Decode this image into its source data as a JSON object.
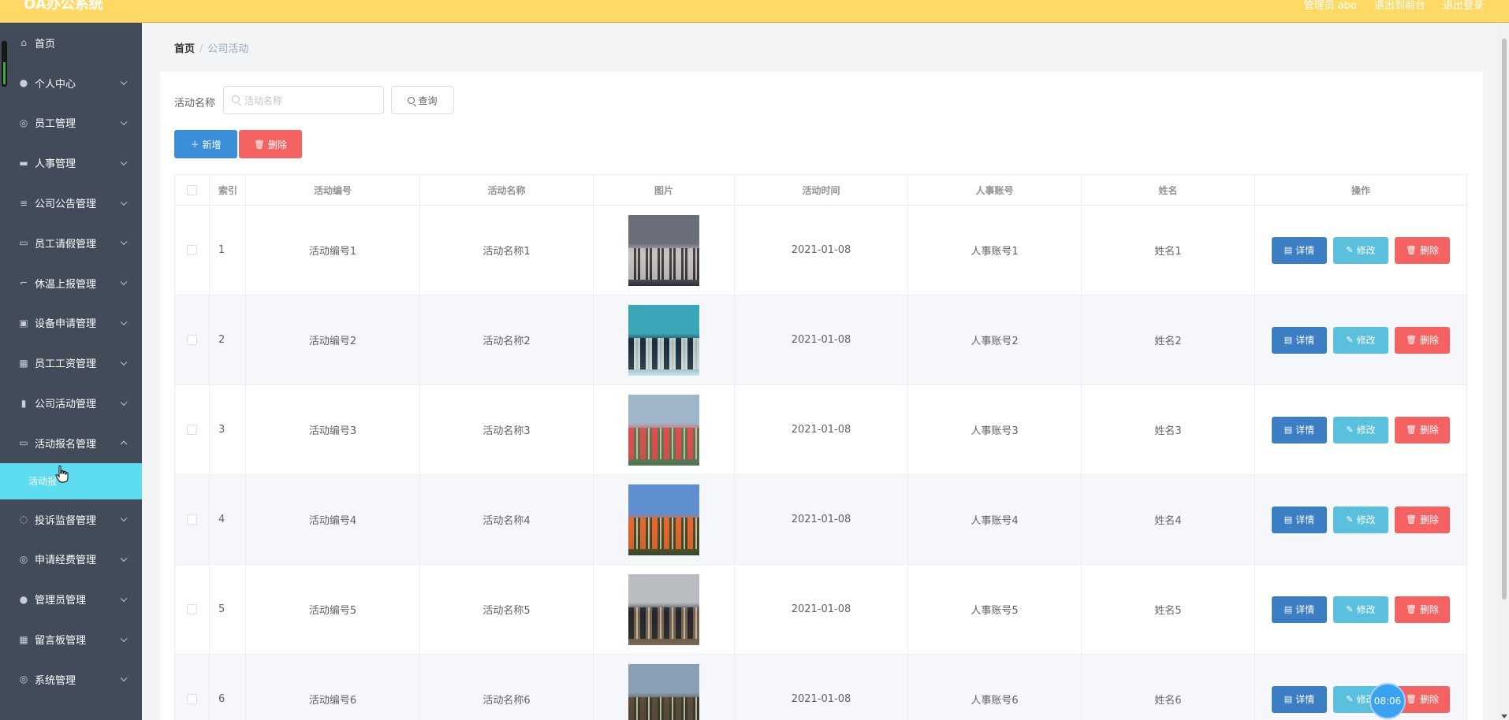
{
  "app": {
    "logo": "OA办公系统",
    "header_links": [
      "管理员 abo",
      "退出到前台",
      "退出登录"
    ]
  },
  "sidebar": {
    "items": [
      {
        "label": "首页",
        "icon": "home-icon",
        "glyph": "⌂",
        "expandable": false
      },
      {
        "label": "个人中心",
        "icon": "user-icon",
        "glyph": "●",
        "expandable": true
      },
      {
        "label": "员工管理",
        "icon": "compass-icon",
        "glyph": "◎",
        "expandable": true
      },
      {
        "label": "人事管理",
        "icon": "printer-icon",
        "glyph": "▬",
        "expandable": true
      },
      {
        "label": "公司公告管理",
        "icon": "list-icon",
        "glyph": "≡",
        "expandable": true
      },
      {
        "label": "员工请假管理",
        "icon": "chat-icon",
        "glyph": "▭",
        "expandable": true
      },
      {
        "label": "休温上报管理",
        "icon": "crop-icon",
        "glyph": "⌐",
        "expandable": true
      },
      {
        "label": "设备申请管理",
        "icon": "briefcase-icon",
        "glyph": "▣",
        "expandable": true
      },
      {
        "label": "员工工资管理",
        "icon": "grid-icon",
        "glyph": "▦",
        "expandable": true
      },
      {
        "label": "公司活动管理",
        "icon": "bar-chart-icon",
        "glyph": "▮",
        "expandable": true
      },
      {
        "label": "活动报名管理",
        "icon": "form-icon",
        "glyph": "▭",
        "expandable": true,
        "open": true
      },
      {
        "label": "投诉监督管理",
        "icon": "help-icon",
        "glyph": "◌",
        "expandable": true
      },
      {
        "label": "申请经费管理",
        "icon": "coin-icon",
        "glyph": "◎",
        "expandable": true
      },
      {
        "label": "管理员管理",
        "icon": "location-icon",
        "glyph": "●",
        "expandable": true
      },
      {
        "label": "留言板管理",
        "icon": "apps-icon",
        "glyph": "▦",
        "expandable": true
      },
      {
        "label": "系统管理",
        "icon": "settings-icon",
        "glyph": "◎",
        "expandable": true
      }
    ],
    "sub_item": "活动报"
  },
  "breadcrumb": {
    "home": "首页",
    "separator": "/",
    "current": "公司活动"
  },
  "search": {
    "label": "活动名称",
    "placeholder": "活动名称",
    "query_button": "查询"
  },
  "actions": {
    "add": "新增",
    "delete": "删除"
  },
  "table": {
    "headers": [
      "索引",
      "活动编号",
      "活动名称",
      "图片",
      "活动时间",
      "人事账号",
      "姓名",
      "操作"
    ],
    "rows": [
      {
        "index": "1",
        "code": "活动编号1",
        "name": "活动名称1",
        "time": "2021-01-08",
        "account": "人事账号1",
        "person": "姓名1",
        "img_colors": [
          "#6b6f7a",
          "#c9c4c0",
          "#2c2f3a"
        ]
      },
      {
        "index": "2",
        "code": "活动编号2",
        "name": "活动名称2",
        "time": "2021-01-08",
        "account": "人事账号2",
        "person": "姓名2",
        "img_colors": [
          "#3aa7b8",
          "#1e2a3a",
          "#c8e6ee"
        ]
      },
      {
        "index": "3",
        "code": "活动编号3",
        "name": "活动名称3",
        "time": "2021-01-08",
        "account": "人事账号3",
        "person": "姓名3",
        "img_colors": [
          "#9fb6c8",
          "#e24b4b",
          "#4a7a52"
        ]
      },
      {
        "index": "4",
        "code": "活动编号4",
        "name": "活动名称4",
        "time": "2021-01-08",
        "account": "人事账号4",
        "person": "姓名4",
        "img_colors": [
          "#5f8fd0",
          "#e8662c",
          "#2f4a2a"
        ]
      },
      {
        "index": "5",
        "code": "活动编号5",
        "name": "活动名称5",
        "time": "2021-01-08",
        "account": "人事账号5",
        "person": "姓名5",
        "img_colors": [
          "#b9bdc2",
          "#24262b",
          "#7e6a55"
        ]
      },
      {
        "index": "6",
        "code": "活动编号6",
        "name": "活动名称6",
        "time": "2021-01-08",
        "account": "人事账号6",
        "person": "姓名6",
        "img_colors": [
          "#8aa0b4",
          "#5a4a3c",
          "#2f3a2a"
        ]
      }
    ],
    "ops": {
      "detail": "详情",
      "edit": "修改",
      "remove": "删除"
    }
  },
  "clock": "08:06",
  "colors": {
    "header": "#ffd966",
    "sidebar": "#414b5a",
    "sidebar_active": "#5ddcf0",
    "primary": "#3b8ed8",
    "danger": "#f56262",
    "info": "#5bc0de"
  }
}
